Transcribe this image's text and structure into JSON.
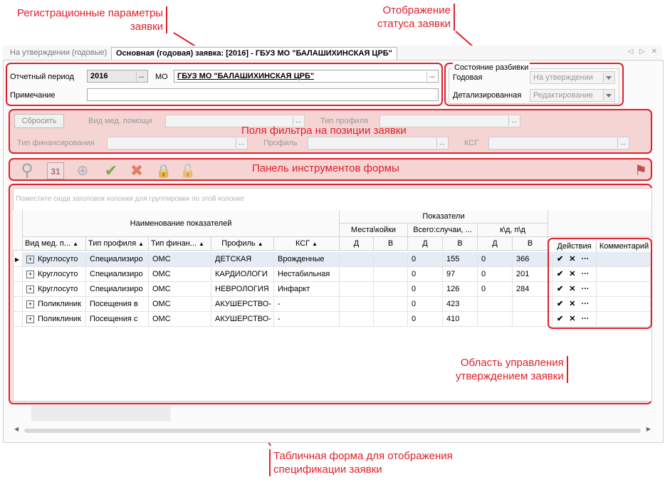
{
  "callouts": {
    "reg_params": [
      "Регистрационные параметры",
      "заявки"
    ],
    "status": [
      "Отображение",
      "статуса заявки"
    ],
    "filter_fields": "Поля фильтра на позиции заявки",
    "toolbar": "Панель инструментов формы",
    "approval_area": [
      "Область управления",
      "утверждением заявки"
    ],
    "table_form": [
      "Табличная форма для отображения",
      "спецификации заявки"
    ]
  },
  "tabs": {
    "inactive": "На утверждении (годовые)",
    "active": "Основная (годовая) заявка: [2016] - ГБУЗ МО \"БАЛАШИХИНСКАЯ ЦРБ\"",
    "nav": "◁ ▷ ✕"
  },
  "header": {
    "period_label": "Отчетный период",
    "period_value": "2016",
    "mo_label": "МО",
    "mo_value": "ГБУЗ МО \"БАЛАШИХИНСКАЯ ЦРБ\"",
    "note_label": "Примечание",
    "note_value": ""
  },
  "status": {
    "group_title": "Состояние разбивки",
    "annual_label": "Годовая",
    "annual_value": "На утверждении",
    "detailed_label": "Детализированная",
    "detailed_value": "Редактирование"
  },
  "filter": {
    "reset_button": "Сбросить",
    "med_help_label": "Вид мед. помощи",
    "profile_type_label": "Тип профиля",
    "finance_type_label": "Тип финансирования",
    "profile_label": "Профиль",
    "ksg_label": "КСГ",
    "dots": "..."
  },
  "toolbar_icons": [
    "search-icon",
    "calendar-icon",
    "preview-icon",
    "check-icon",
    "cross-icon",
    "lock-icon",
    "unlock-icon",
    "flag-icon"
  ],
  "toolbar_glyphs": {
    "search": "⚲",
    "calendar": "31",
    "preview": "⊕",
    "check": "✔",
    "cross": "✖",
    "lock": "🔒",
    "unlock": "🔓",
    "flag": "⚑"
  },
  "grid": {
    "group_hint": "Поместите сюда заголовок колонки для группировки по этой колонке",
    "header_name_group": "Наименование показателей",
    "header_indicators": "Показатели",
    "sub_places": "Места\\койки",
    "sub_total": "Всего:случаи, ...",
    "sub_kd": "к\\д, п\\д",
    "d": "Д",
    "v": "В",
    "columns": [
      "Вид мед. п...",
      "Тип профиля",
      "Тип финан...",
      "Профиль",
      "КСГ"
    ],
    "actions_header": "Действия",
    "comment_header": "Комментарий",
    "action_symbols": [
      "✔",
      "✕",
      "···"
    ],
    "rows": [
      {
        "c1": "Круглосуто",
        "c2": "Специализиро",
        "c3": "ОМС",
        "c4": "ДЕТСКАЯ",
        "c5": "Врожденные",
        "td": "0",
        "tv": "155",
        "kd": "0",
        "kv": "366"
      },
      {
        "c1": "Круглосуто",
        "c2": "Специализиро",
        "c3": "ОМС",
        "c4": "КАРДИОЛОГИ",
        "c5": "Нестабильная",
        "td": "0",
        "tv": "97",
        "kd": "0",
        "kv": "201"
      },
      {
        "c1": "Круглосуто",
        "c2": "Специализиро",
        "c3": "ОМС",
        "c4": "НЕВРОЛОГИЯ",
        "c5": "Инфаркт",
        "td": "0",
        "tv": "126",
        "kd": "0",
        "kv": "284"
      },
      {
        "c1": "Поликлиник",
        "c2": "Посещения в",
        "c3": "ОМС",
        "c4": "АКУШЕРСТВО-",
        "c5": "-",
        "td": "0",
        "tv": "423",
        "kd": "",
        "kv": ""
      },
      {
        "c1": "Поликлиник",
        "c2": "Посещения с",
        "c3": "ОМС",
        "c4": "АКУШЕРСТВО-",
        "c5": "-",
        "td": "0",
        "tv": "410",
        "kd": "",
        "kv": ""
      }
    ]
  }
}
